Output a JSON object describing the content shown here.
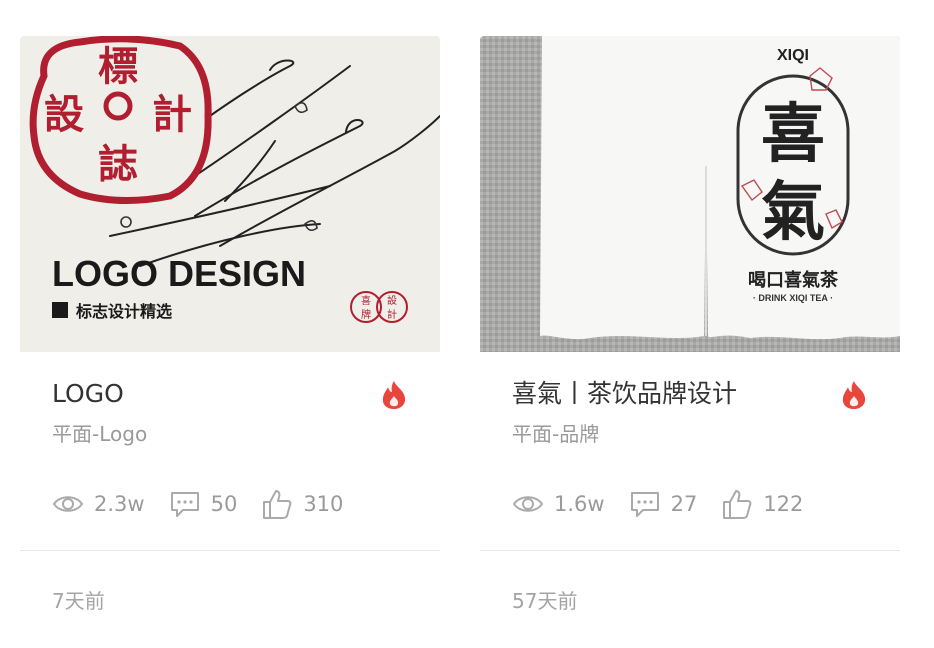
{
  "cards": [
    {
      "cover": {
        "seal_chars": [
          "標",
          "設",
          "計",
          "誌"
        ],
        "headline": "LOGO DESIGN",
        "subline": "标志设计精选",
        "mini_seal": [
          "喜",
          "設",
          "牌",
          "計"
        ]
      },
      "title": "LOGO",
      "category": "平面-Logo",
      "views": "2.3w",
      "comments": "50",
      "likes": "310",
      "time": "7天前"
    },
    {
      "cover": {
        "brand": "XIQI",
        "big_chars": [
          "喜",
          "氣"
        ],
        "slogan": "喝口喜氣茶",
        "slogan_en": "· DRINK XIQI TEA ·"
      },
      "title": "喜氣丨茶饮品牌设计",
      "category": "平面-品牌",
      "views": "1.6w",
      "comments": "27",
      "likes": "122",
      "time": "57天前"
    }
  ],
  "colors": {
    "accent_red": "#e8453c",
    "meta_gray": "#9a9a9a",
    "seal_red": "#b01e2f"
  }
}
